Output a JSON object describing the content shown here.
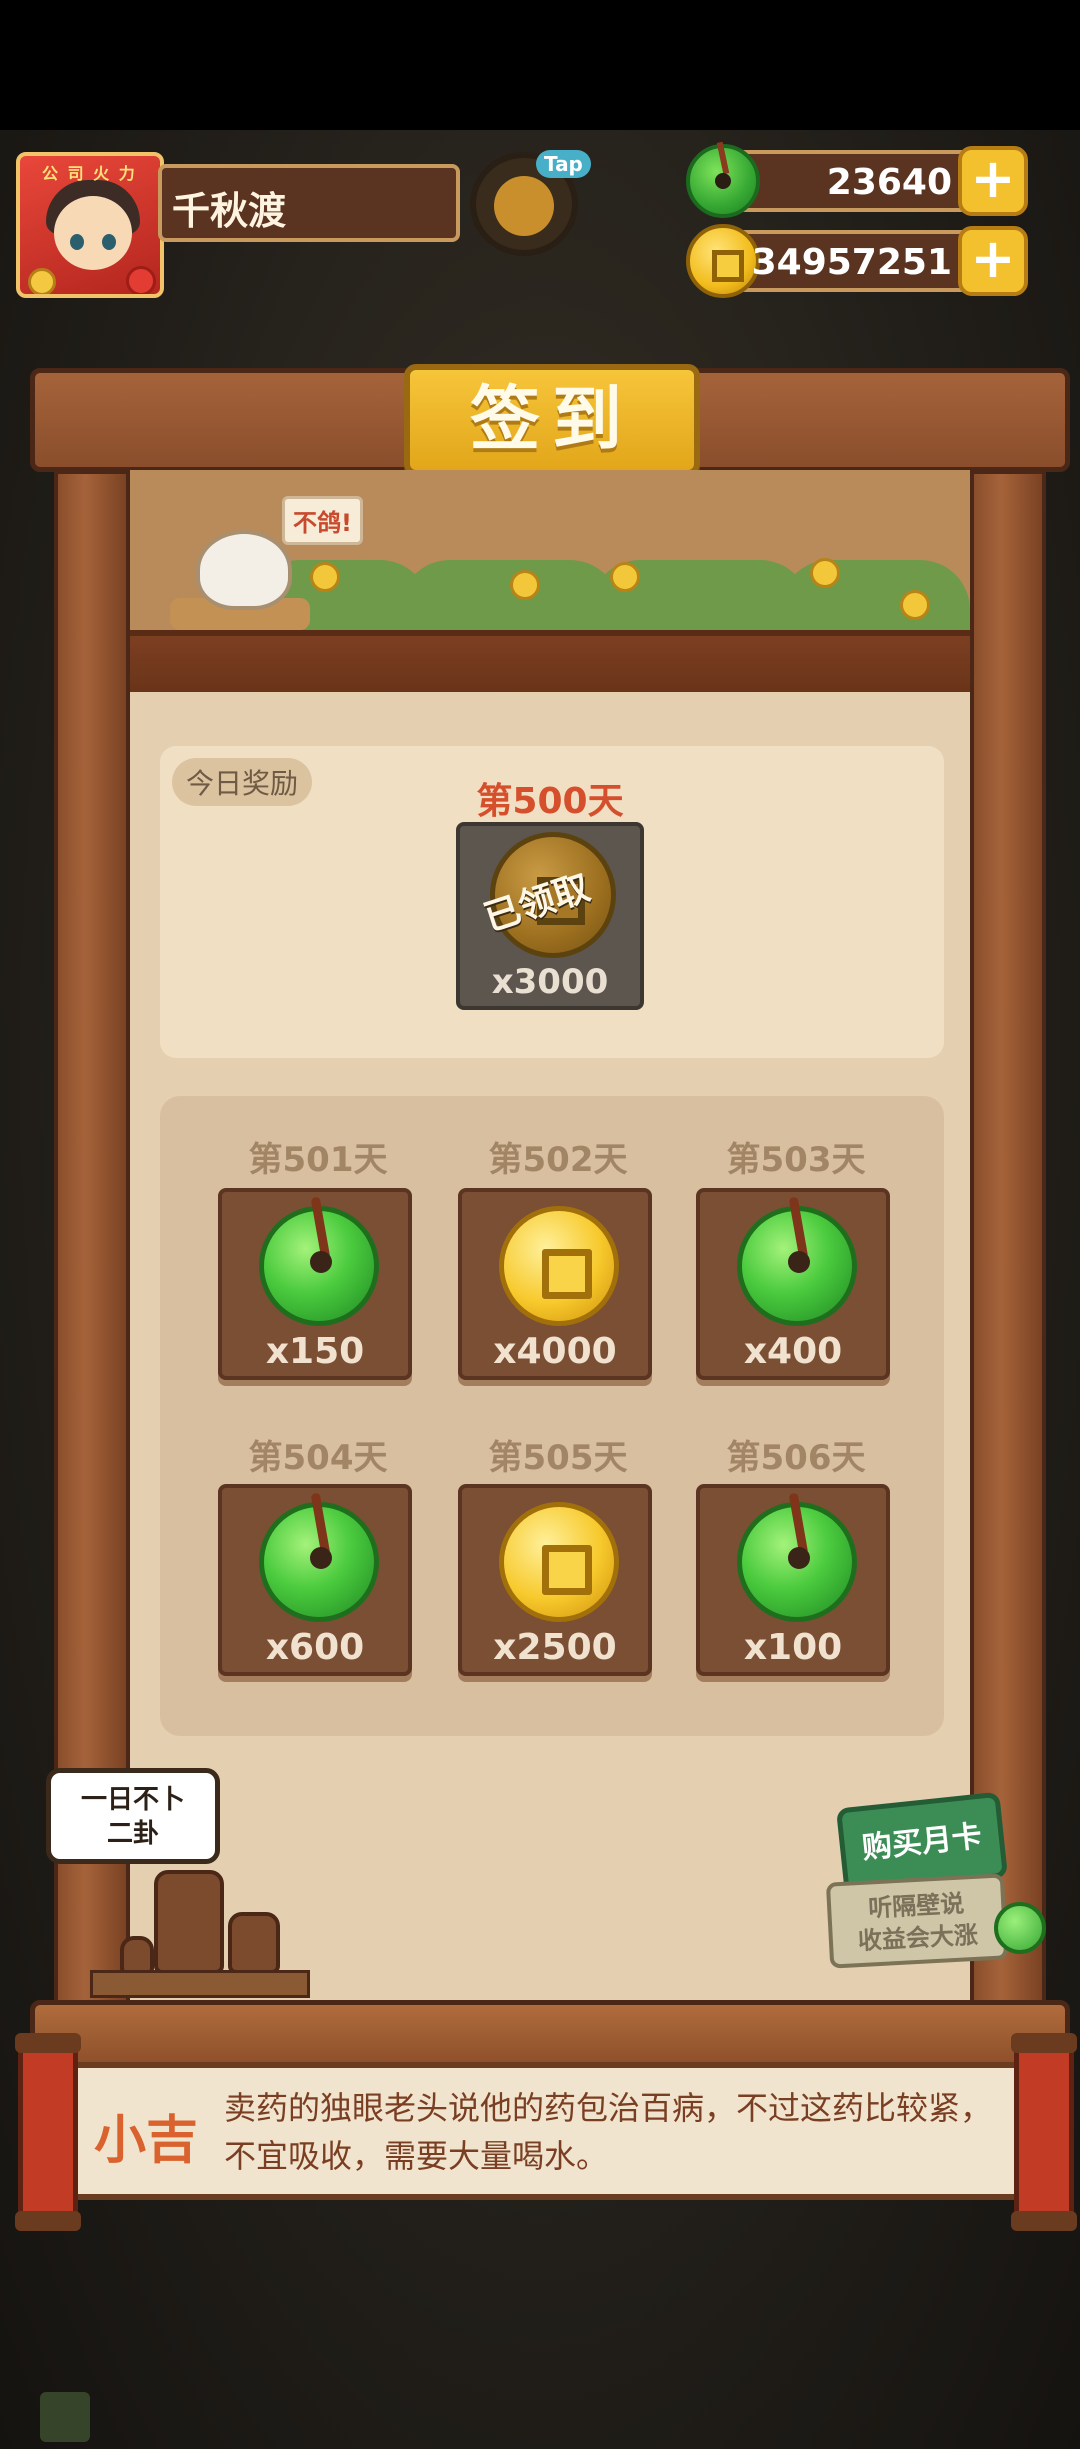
{
  "player": {
    "name": "千秋渡",
    "avatar_tag": "公 司 火 力"
  },
  "hud": {
    "tap_label": "Tap",
    "jade": {
      "value": "23640",
      "icon": "jade-coin-icon"
    },
    "gold": {
      "value": "34957251",
      "icon": "gold-coin-icon"
    },
    "plus_label": "+"
  },
  "panel": {
    "title": "签到",
    "bird_speech": "不鸽!",
    "today": {
      "label": "今日奖励",
      "day": "第500天",
      "status": "已领取",
      "qty": "x3000"
    },
    "days": [
      {
        "day": "第501天",
        "reward": "jade",
        "qty": "x150"
      },
      {
        "day": "第502天",
        "reward": "gold",
        "qty": "x4000"
      },
      {
        "day": "第503天",
        "reward": "jade",
        "qty": "x400"
      },
      {
        "day": "第504天",
        "reward": "jade",
        "qty": "x600"
      },
      {
        "day": "第505天",
        "reward": "gold",
        "qty": "x2500"
      },
      {
        "day": "第506天",
        "reward": "jade",
        "qty": "x100"
      }
    ]
  },
  "scene": {
    "speech": [
      "一日不卜",
      "二卦"
    ],
    "monthly_card": {
      "button": "购买月卡",
      "caption": [
        "听隔壁说",
        "收益会大涨"
      ]
    }
  },
  "dialog": {
    "speaker": "小吉",
    "text": "卖药的独眼老头说他的药包治百病，不过这药比较紧，不宜吸收，需要大量喝水。"
  },
  "colors": {
    "accent_gold": "#f4c12e",
    "wood": "#8a4e2c",
    "jade": "#35a733",
    "day_highlight": "#d64f2c"
  }
}
